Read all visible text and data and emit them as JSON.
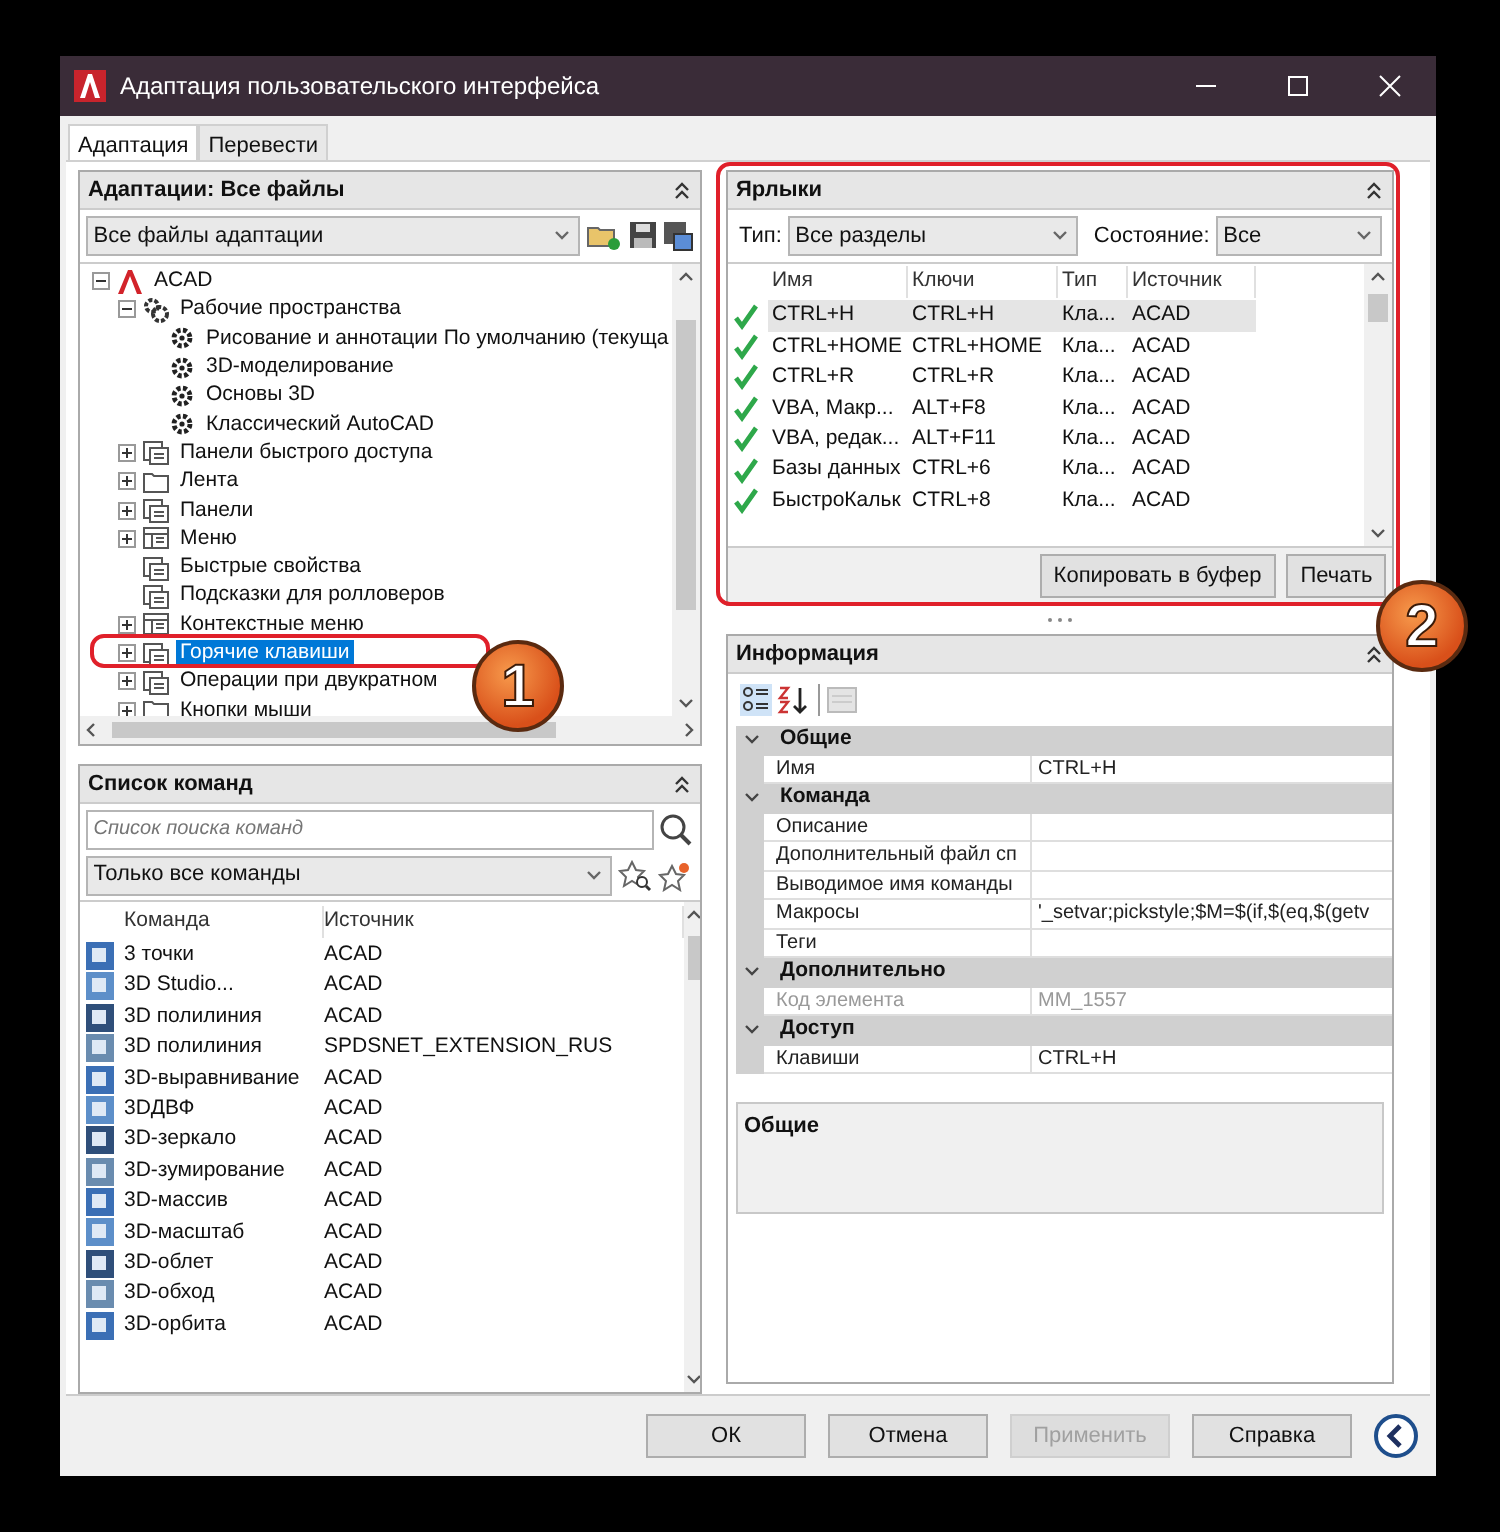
{
  "window": {
    "title": "Адаптация пользовательского интерфейса"
  },
  "tabs": [
    {
      "label": "Адаптация",
      "selected": true
    },
    {
      "label": "Перевести",
      "selected": false
    }
  ],
  "customizations": {
    "title": "Адаптации: Все файлы",
    "file_filter": "Все файлы адаптации",
    "tree": [
      {
        "label": "ACAD",
        "kind": "logo",
        "expanded": true,
        "selected": false,
        "children": [
          {
            "label": "Рабочие пространства",
            "kind": "gears",
            "expanded": true,
            "selected": false,
            "children": [
              {
                "label": "Рисование и аннотации По умолчанию (текуща",
                "kind": "gear",
                "selected": false
              },
              {
                "label": "3D-моделирование",
                "kind": "gear",
                "selected": false
              },
              {
                "label": "Основы 3D",
                "kind": "gear",
                "selected": false
              },
              {
                "label": "Классический AutoCAD",
                "kind": "gear",
                "selected": false
              }
            ]
          },
          {
            "label": "Панели быстрого доступа",
            "kind": "panel",
            "expanded": false,
            "selected": false
          },
          {
            "label": "Лента",
            "kind": "folder",
            "expanded": false,
            "selected": false
          },
          {
            "label": "Панели",
            "kind": "panel",
            "expanded": false,
            "selected": false
          },
          {
            "label": "Меню",
            "kind": "menu",
            "expanded": false,
            "selected": false
          },
          {
            "label": "Быстрые свойства",
            "kind": "panel",
            "selected": false
          },
          {
            "label": "Подсказки для ролловеров",
            "kind": "panel",
            "selected": false
          },
          {
            "label": "Контекстные меню",
            "kind": "menu",
            "expanded": false,
            "selected": false
          },
          {
            "label": "Горячие клавиши",
            "kind": "panel",
            "expanded": false,
            "selected": true
          },
          {
            "label": "Операции при двукратном",
            "kind": "panel",
            "expanded": false,
            "selected": false
          },
          {
            "label": "Кнопки мыши",
            "kind": "folder",
            "expanded": false,
            "selected": false
          }
        ]
      }
    ]
  },
  "command_list": {
    "title": "Список команд",
    "search": {
      "placeholder": "Список поиска команд"
    },
    "filter": "Только все команды",
    "columns": [
      "Команда",
      "Источник"
    ],
    "rows": [
      {
        "command": "3 точки",
        "source": "ACAD"
      },
      {
        "command": "3D Studio...",
        "source": "ACAD"
      },
      {
        "command": "3D полилиния",
        "source": "ACAD"
      },
      {
        "command": "3D полилиния",
        "source": "SPDSNET_EXTENSION_RUS"
      },
      {
        "command": "3D-выравнивание",
        "source": "ACAD"
      },
      {
        "command": "3DДВФ",
        "source": "ACAD"
      },
      {
        "command": "3D-зеркало",
        "source": "ACAD"
      },
      {
        "command": "3D-зумирование",
        "source": "ACAD"
      },
      {
        "command": "3D-массив",
        "source": "ACAD"
      },
      {
        "command": "3D-масштаб",
        "source": "ACAD"
      },
      {
        "command": "3D-облет",
        "source": "ACAD"
      },
      {
        "command": "3D-обход",
        "source": "ACAD"
      },
      {
        "command": "3D-орбита",
        "source": "ACAD"
      }
    ]
  },
  "shortcuts": {
    "title": "Ярлыки",
    "type_label": "Тип:",
    "type_value": "Все разделы",
    "state_label": "Состояние:",
    "state_value": "Все",
    "columns": [
      "Имя",
      "Ключи",
      "Тип",
      "Источник"
    ],
    "rows": [
      {
        "name": "CTRL+H",
        "keys": "CTRL+H",
        "type": "Кла...",
        "source": "ACAD",
        "selected": true
      },
      {
        "name": "CTRL+HOME",
        "keys": "CTRL+HOME",
        "type": "Кла...",
        "source": "ACAD",
        "selected": false
      },
      {
        "name": "CTRL+R",
        "keys": "CTRL+R",
        "type": "Кла...",
        "source": "ACAD",
        "selected": false
      },
      {
        "name": "VBA, Макр...",
        "keys": "ALT+F8",
        "type": "Кла...",
        "source": "ACAD",
        "selected": false
      },
      {
        "name": "VBA, редак...",
        "keys": "ALT+F11",
        "type": "Кла...",
        "source": "ACAD",
        "selected": false
      },
      {
        "name": "Базы данных",
        "keys": "CTRL+6",
        "type": "Кла...",
        "source": "ACAD",
        "selected": false
      },
      {
        "name": "БыстроКальк",
        "keys": "CTRL+8",
        "type": "Кла...",
        "source": "ACAD",
        "selected": false
      }
    ],
    "buttons": [
      "Копировать в буфер",
      "Печать"
    ]
  },
  "information": {
    "title": "Информация",
    "categories": [
      {
        "label": "Общие",
        "expanded": true,
        "properties": [
          {
            "name": "Имя",
            "value": "CTRL+H",
            "disabled": false
          }
        ]
      },
      {
        "label": "Команда",
        "expanded": true,
        "properties": [
          {
            "name": "Описание",
            "disabled": false
          },
          {
            "name": "Дополнительный файл сп",
            "disabled": false
          },
          {
            "name": "Выводимое имя команды",
            "disabled": false
          },
          {
            "name": "Макросы",
            "value": "'_setvar;pickstyle;$M=$(if,$(eq,$(getv",
            "disabled": false
          },
          {
            "name": "Теги",
            "disabled": false
          }
        ]
      },
      {
        "label": "Дополнительно",
        "expanded": true,
        "properties": [
          {
            "name": "Код элемента",
            "value": "MM_1557",
            "disabled": true
          }
        ]
      },
      {
        "label": "Доступ",
        "expanded": true,
        "properties": [
          {
            "name": "Клавиши",
            "value": "CTRL+H",
            "disabled": false
          }
        ]
      }
    ],
    "description_title": "Общие"
  },
  "buttons": [
    {
      "label": "ОК",
      "disabled": false
    },
    {
      "label": "Отмена",
      "disabled": false
    },
    {
      "label": "Применить",
      "disabled": true
    },
    {
      "label": "Справка",
      "disabled": false
    }
  ],
  "annotations": [
    {
      "label": "1"
    },
    {
      "label": "2"
    }
  ]
}
